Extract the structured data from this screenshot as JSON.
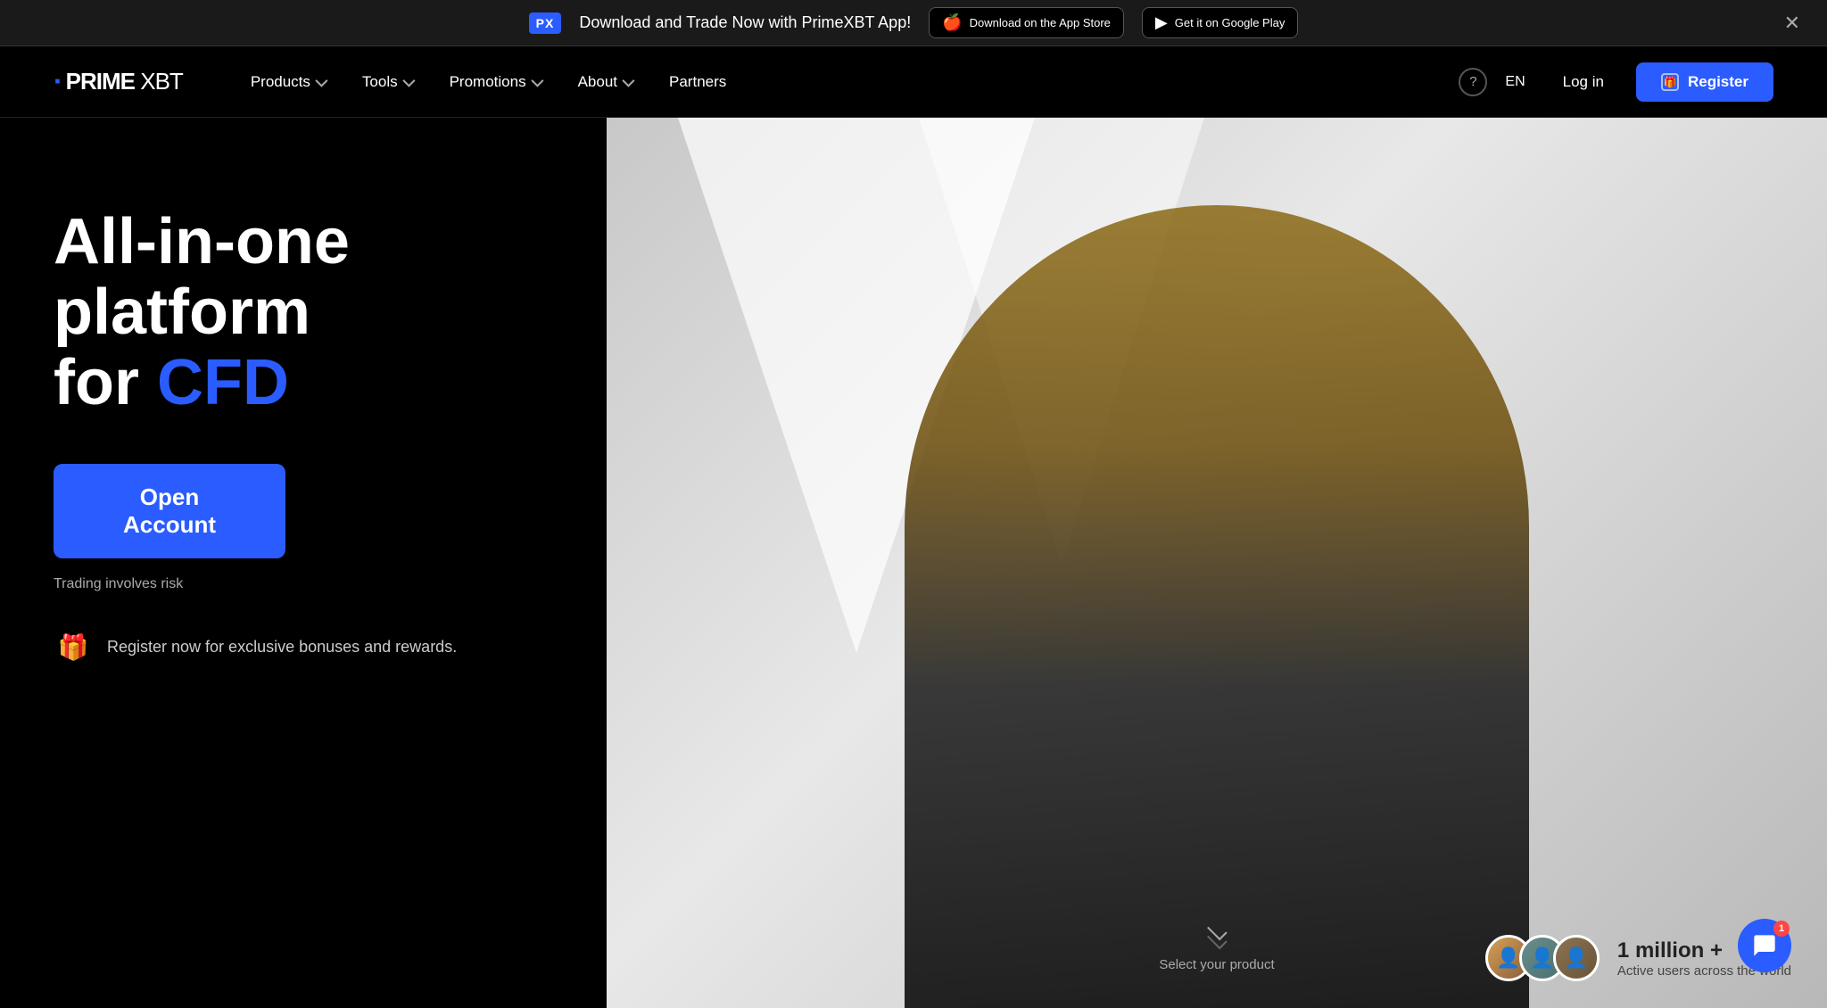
{
  "announcement": {
    "px_logo": "PX",
    "text": "Download and Trade Now with PrimeXBT App!",
    "app_store_label": "Download on the App Store",
    "google_play_label": "Get it on Google Play",
    "close_label": "✕"
  },
  "navbar": {
    "logo": "PRIME XBT",
    "logo_dot": "·",
    "nav_items": [
      {
        "label": "Products",
        "has_dropdown": true
      },
      {
        "label": "Tools",
        "has_dropdown": true
      },
      {
        "label": "Promotions",
        "has_dropdown": true
      },
      {
        "label": "About",
        "has_dropdown": true
      },
      {
        "label": "Partners",
        "has_dropdown": false
      }
    ],
    "help_icon": "?",
    "lang": "EN",
    "login_label": "Log in",
    "register_label": "Register"
  },
  "hero": {
    "title_line1": "All-in-one platform",
    "title_line2": "for ",
    "title_blue": "CFD",
    "cta_button": "Open Account",
    "risk_text": "Trading involves risk",
    "bonus_text": "Register now for exclusive bonuses and rewards.",
    "bonus_icon": "🎁"
  },
  "stats": {
    "million": "1 million +",
    "active": "Active users across the world"
  },
  "scroll": {
    "label": "Select your product"
  },
  "chat": {
    "badge": "1"
  }
}
